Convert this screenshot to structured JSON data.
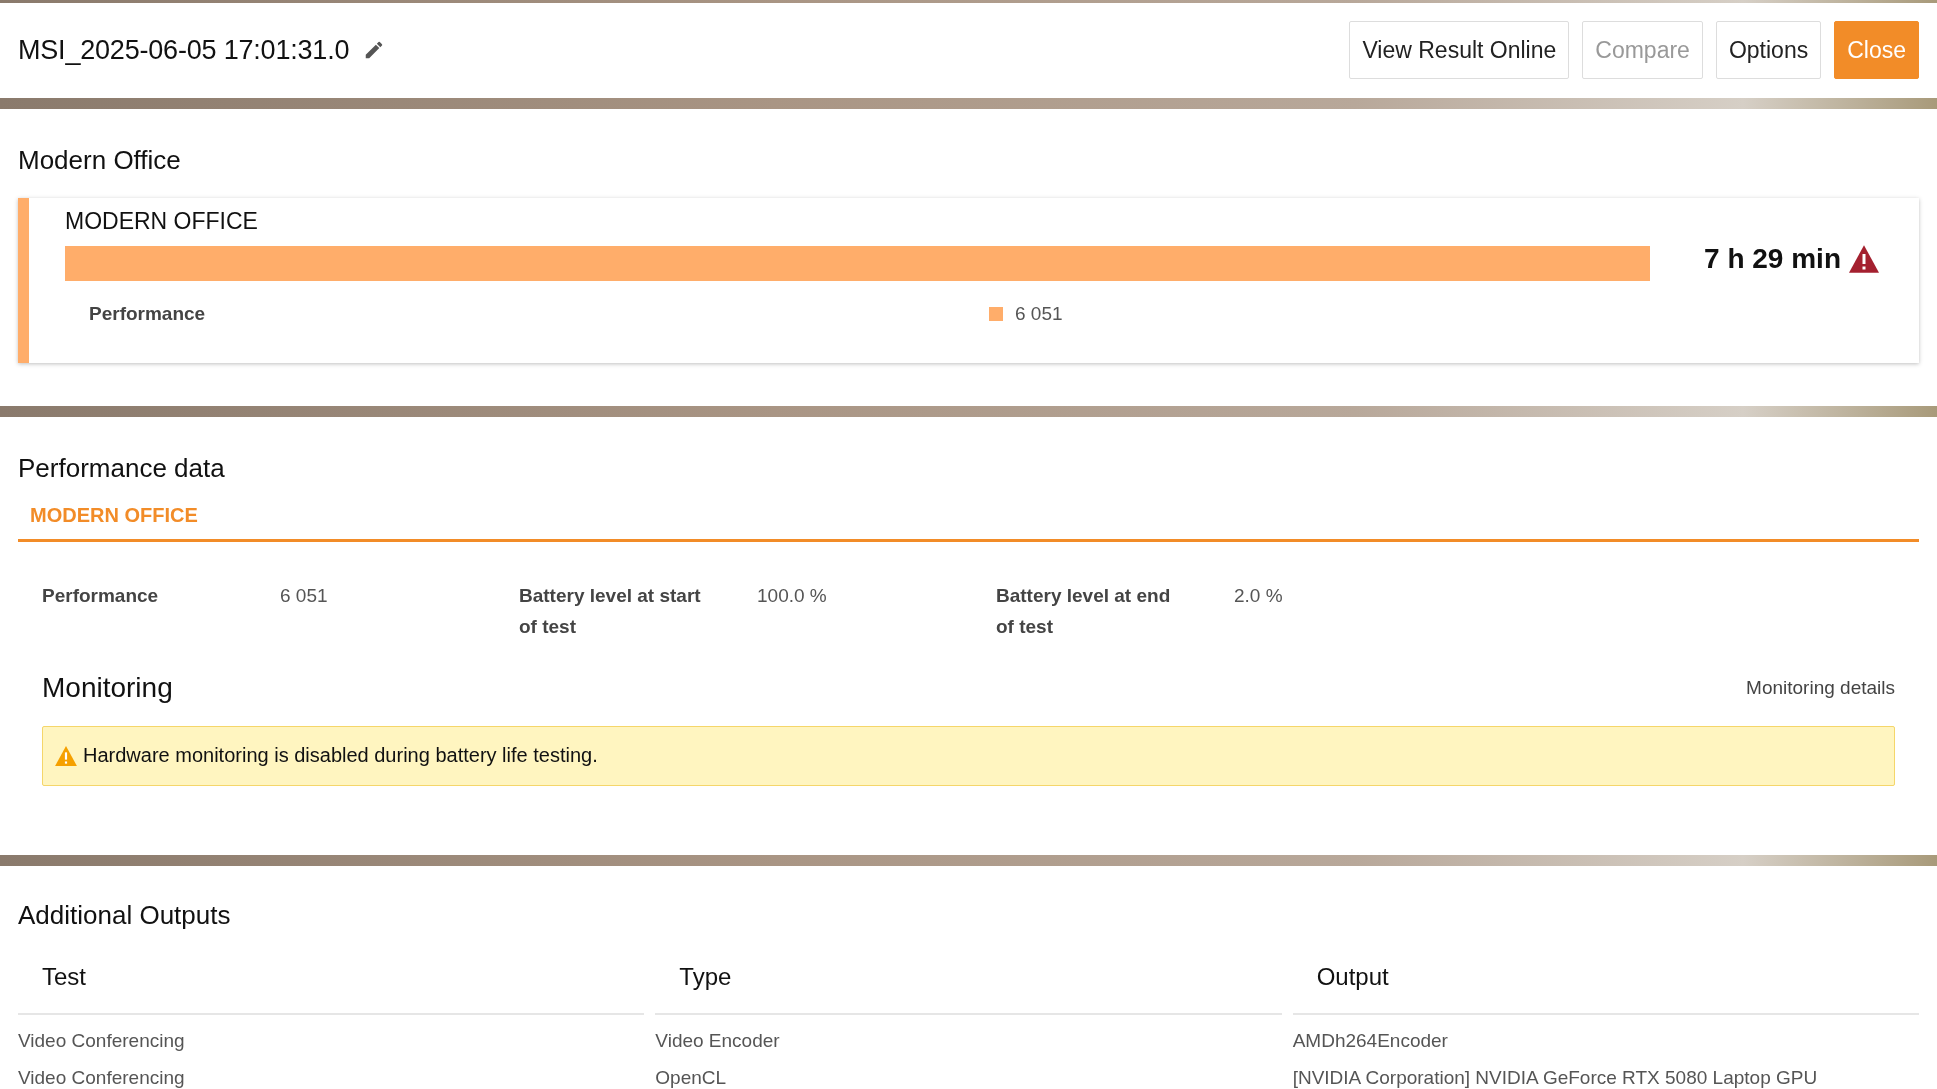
{
  "header": {
    "title": "MSI_2025-06-05 17:01:31.0",
    "buttons": [
      {
        "label": "View Result Online",
        "kind": "default",
        "disabled": false
      },
      {
        "label": "Compare",
        "kind": "default",
        "disabled": true
      },
      {
        "label": "Options",
        "kind": "default",
        "disabled": false
      },
      {
        "label": "Close",
        "kind": "primary",
        "disabled": false
      }
    ]
  },
  "result_section": {
    "title": "Modern Office",
    "card": {
      "name": "MODERN OFFICE",
      "result": "7 h 29 min",
      "warning": true,
      "metric_label": "Performance",
      "metric_value": "6 051"
    }
  },
  "performance_data": {
    "title": "Performance data",
    "tabs": [
      {
        "label": "MODERN OFFICE",
        "selected": true
      }
    ],
    "fields": [
      {
        "label": "Performance",
        "value": "6 051"
      },
      {
        "label": "Battery level at start of test",
        "value": "100.0 %"
      },
      {
        "label": "Battery level at end of test",
        "value": "2.0 %"
      }
    ],
    "monitoring": {
      "title": "Monitoring",
      "link": "Monitoring details",
      "notice": "Hardware monitoring is disabled during battery life testing."
    }
  },
  "additional_outputs": {
    "title": "Additional Outputs",
    "columns": [
      "Test",
      "Type",
      "Output"
    ],
    "rows": [
      [
        "Video Conferencing",
        "Video Encoder",
        "AMDh264Encoder"
      ],
      [
        "Video Conferencing",
        "OpenCL",
        "[NVIDIA Corporation] NVIDIA GeForce RTX 5080 Laptop GPU"
      ]
    ]
  }
}
